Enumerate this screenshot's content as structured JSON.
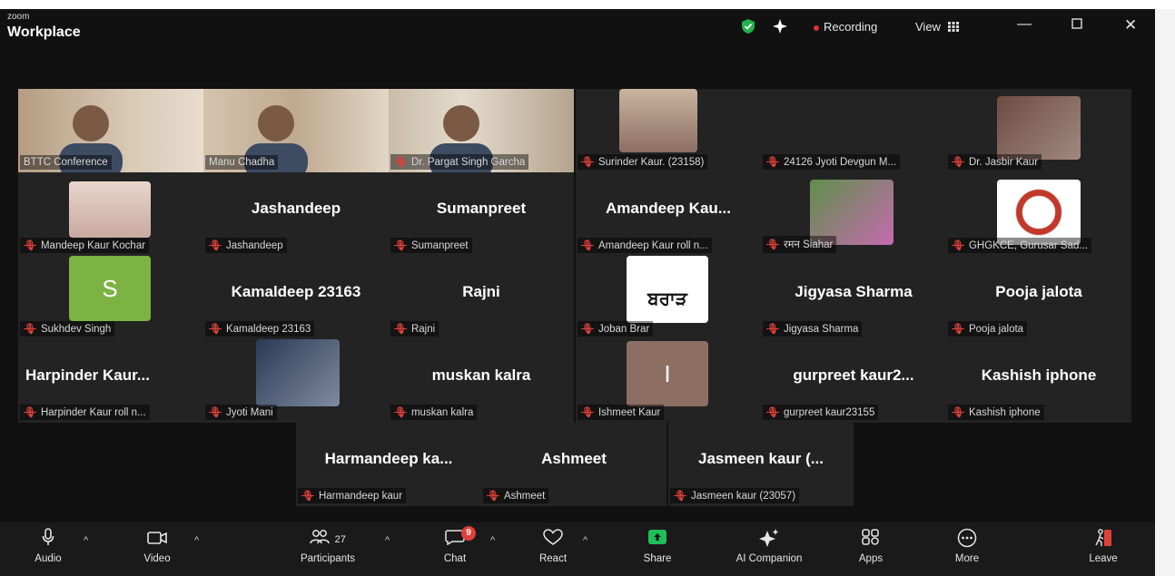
{
  "titlebar": {
    "brand_small": "zoom",
    "brand_big": "Workplace",
    "recording": "Recording",
    "view": "View",
    "view_icon": "grid-icon"
  },
  "tiles": [
    {
      "label": "BTTC Conference",
      "muted": false,
      "video": true
    },
    {
      "label": "Manu Chadha",
      "muted": false,
      "video": true
    },
    {
      "label": "Dr. Pargat Singh Garcha",
      "muted": true,
      "video": true
    },
    {
      "label": "Surinder Kaur. (23158)",
      "muted": true,
      "thumb": true
    },
    {
      "label": "24126 Jyoti Devgun M...",
      "muted": true
    },
    {
      "label": "Dr. Jasbir Kaur",
      "muted": true,
      "thumb": true
    },
    {
      "label": "Mandeep Kaur Kochar",
      "muted": true,
      "thumb": true
    },
    {
      "big": "Jashandeep",
      "label": "Jashandeep",
      "muted": true
    },
    {
      "big": "Sumanpreet",
      "label": "Sumanpreet",
      "muted": true
    },
    {
      "big": "Amandeep  Kau...",
      "label": "Amandeep Kaur roll n...",
      "muted": true
    },
    {
      "label": "रमन Siahar",
      "muted": true,
      "thumb": true
    },
    {
      "label": "GHGKCE, Gurusar Sad...",
      "muted": true,
      "thumb": true
    },
    {
      "avatar": "S",
      "label": "Sukhdev Singh",
      "muted": true
    },
    {
      "big": "Kamaldeep 23163",
      "label": "Kamaldeep 23163",
      "muted": true
    },
    {
      "big": "Rajni",
      "label": "Rajni",
      "muted": true
    },
    {
      "logo": "ਬਰਾੜ",
      "label": "Joban Brar",
      "muted": true
    },
    {
      "big": "Jigyasa Sharma",
      "label": "Jigyasa Sharma",
      "muted": true
    },
    {
      "big": "Pooja jalota",
      "label": "Pooja jalota",
      "muted": true
    },
    {
      "big": "Harpinder  Kaur...",
      "label": "Harpinder Kaur  roll n...",
      "muted": true,
      "left": true
    },
    {
      "label": "Jyoti Mani",
      "muted": true,
      "thumb": true
    },
    {
      "big": "muskan kalra",
      "label": "muskan kalra",
      "muted": true
    },
    {
      "avatar": "I",
      "label": "Ishmeet Kaur",
      "muted": true
    },
    {
      "big": "gurpreet  kaur2...",
      "label": "gurpreet kaur23155",
      "muted": true
    },
    {
      "big": "Kashish iphone",
      "label": "Kashish iphone",
      "muted": true
    }
  ],
  "lastrow": [
    {
      "big": "Harmandeep  ka...",
      "label": "Harmandeep kaur",
      "muted": true
    },
    {
      "big": "Ashmeet",
      "label": "Ashmeet",
      "muted": true
    },
    {
      "big": "Jasmeen  kaur  (...",
      "label": "Jasmeen kaur (23057)",
      "muted": true
    }
  ],
  "controls": {
    "audio": "Audio",
    "video": "Video",
    "participants": "Participants",
    "participants_count": "27",
    "chat": "Chat",
    "chat_badge": "9",
    "react": "React",
    "share": "Share",
    "ai": "AI Companion",
    "apps": "Apps",
    "more": "More",
    "leave": "Leave"
  },
  "colors": {
    "accent_green": "#3cc27a",
    "share_green": "#1fbe5a",
    "leave_red": "#e0403a",
    "badge_red": "#e0403a"
  }
}
